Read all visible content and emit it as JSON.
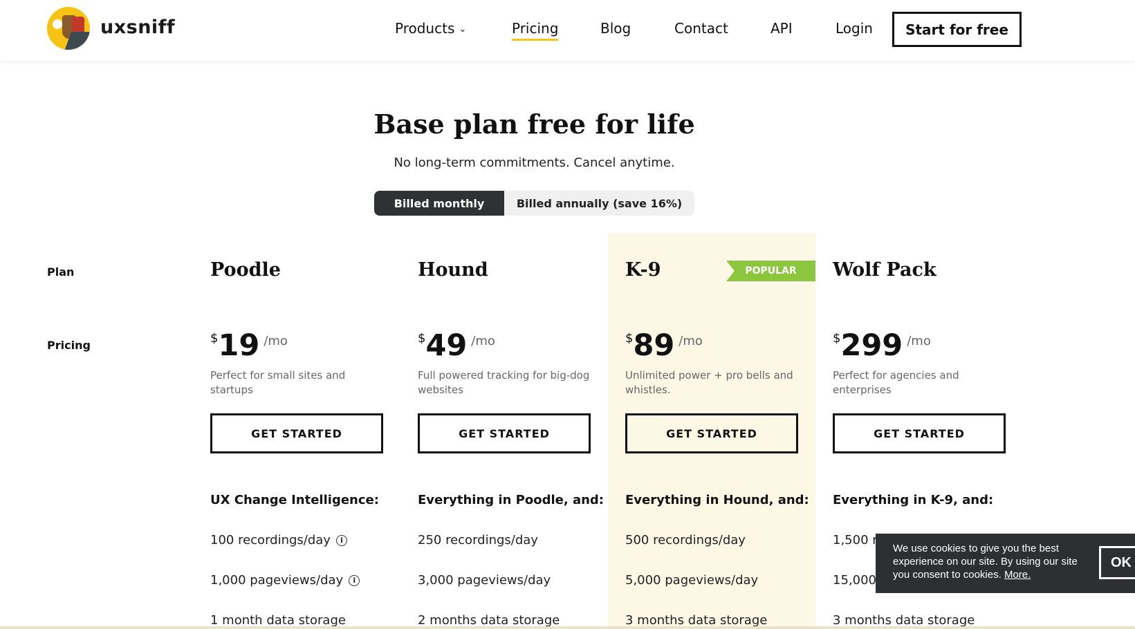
{
  "header": {
    "brand": "uxsniff",
    "nav": {
      "products": "Products",
      "pricing": "Pricing",
      "blog": "Blog",
      "contact": "Contact",
      "api": "API",
      "login": "Login"
    },
    "cta": "Start for free"
  },
  "hero": {
    "title": "Base plan free for life",
    "subtitle": "No long-term commitments. Cancel anytime.",
    "billing_toggle": {
      "monthly": "Billed monthly",
      "annual": "Billed annually (save 16%)",
      "selected": "monthly"
    }
  },
  "table": {
    "row_labels": {
      "plan": "Plan",
      "pricing": "Pricing"
    },
    "popular_badge": "POPULAR",
    "plans": [
      {
        "name": "Poodle",
        "currency": "$",
        "price": "19",
        "period": "/mo",
        "description": "Perfect for small sites and startups",
        "button": "GET STARTED",
        "features_heading": "UX Change Intelligence:",
        "features": [
          "100 recordings/day",
          "1,000 pageviews/day",
          "1 month data storage"
        ]
      },
      {
        "name": "Hound",
        "currency": "$",
        "price": "49",
        "period": "/mo",
        "description": "Full powered tracking for big-dog websites",
        "button": "GET STARTED",
        "features_heading": "Everything in Poodle, and:",
        "features": [
          "250 recordings/day",
          "3,000 pageviews/day",
          "2 months data storage"
        ]
      },
      {
        "name": "K-9",
        "currency": "$",
        "price": "89",
        "period": "/mo",
        "description": "Unlimited power + pro bells and whistles.",
        "button": "GET STARTED",
        "features_heading": "Everything in Hound, and:",
        "features": [
          "500 recordings/day",
          "5,000 pageviews/day",
          "3 months data storage"
        ]
      },
      {
        "name": "Wolf Pack",
        "currency": "$",
        "price": "299",
        "period": "/mo",
        "description": "Perfect for agencies and enterprises",
        "button": "GET STARTED",
        "features_heading": "Everything in K-9, and:",
        "features": [
          "1,500 re",
          "15,000",
          "3 months data storage"
        ]
      }
    ],
    "info_icon": "i"
  },
  "cookie": {
    "text": "We use cookies to give you the best experience on our site. By using our site you consent to cookies.",
    "more": "More.",
    "ok": "OK"
  },
  "colors": {
    "accent_yellow": "#f7c415",
    "popular_green": "#8cc63f",
    "highlight_bg": "#fdf8e6",
    "toggle_dark": "#2f3233",
    "cookie_bg": "#2d3033"
  }
}
